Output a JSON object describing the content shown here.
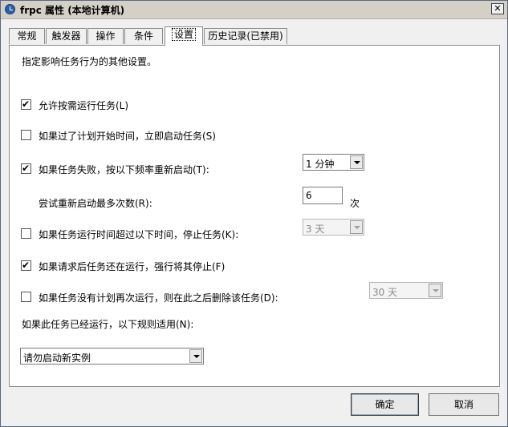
{
  "window": {
    "title": "frpc 属性 (本地计算机)",
    "close_glyph": "✕"
  },
  "tabs": [
    {
      "label": "常规"
    },
    {
      "label": "触发器"
    },
    {
      "label": "操作"
    },
    {
      "label": "条件"
    },
    {
      "label": "设置",
      "active": true
    },
    {
      "label": "历史记录(已禁用)"
    }
  ],
  "settings": {
    "intro": "指定影响任务行为的其他设置。",
    "allow_on_demand": {
      "label": "允许按需运行任务(L)",
      "checked": true
    },
    "start_if_missed": {
      "label": "如果过了计划开始时间，立即启动任务(S)",
      "checked": false
    },
    "restart_on_fail": {
      "label": "如果任务失败，按以下频率重新启动(T):",
      "checked": true,
      "interval": "1 分钟"
    },
    "retry_count": {
      "label": "尝试重新启动最多次数(R):",
      "value": "6",
      "unit": "次"
    },
    "stop_if_longer": {
      "label": "如果任务运行时间超过以下时间，停止任务(K):",
      "checked": false,
      "duration": "3 天"
    },
    "force_stop": {
      "label": "如果请求后任务还在运行，强行将其停止(F)",
      "checked": true
    },
    "delete_if_not_scheduled": {
      "label": "如果任务没有计划再次运行，则在此之后删除该任务(D):",
      "checked": false,
      "after": "30 天"
    },
    "rule_label": "如果此任务已经运行，以下规则适用(N):",
    "rule_value": "请勿启动新实例"
  },
  "buttons": {
    "ok": "确定",
    "cancel": "取消"
  }
}
